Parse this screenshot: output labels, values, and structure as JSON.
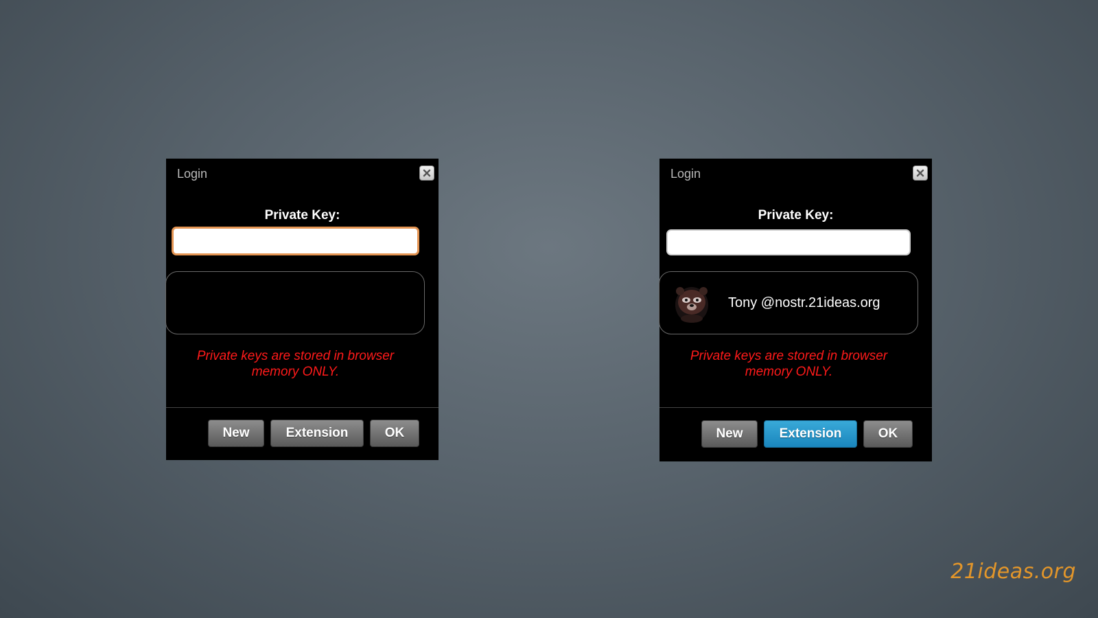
{
  "dialogs": [
    {
      "title": "Login",
      "private_key_label": "Private Key:",
      "private_key_value": "",
      "profile": null,
      "warning_line1": "Private keys are stored in browser",
      "warning_line2": "memory ONLY.",
      "buttons": {
        "new": "New",
        "extension": "Extension",
        "ok": "OK"
      },
      "input_state": "focused"
    },
    {
      "title": "Login",
      "private_key_label": "Private Key:",
      "private_key_value": "",
      "profile": {
        "name": "Tony @nostr.21ideas.org",
        "avatar_icon": "bear-avatar-icon"
      },
      "warning_line1": "Private keys are stored in browser",
      "warning_line2": "memory ONLY.",
      "buttons": {
        "new": "New",
        "extension": "Extension",
        "ok": "OK"
      },
      "active_button": "extension"
    }
  ],
  "brand": "21ideas.org",
  "colors": {
    "background": "#58636c",
    "dialog": "#000000",
    "warning": "#ff1a1a",
    "focus_ring": "#e49452",
    "active_button": "#1a86bd",
    "brand": "#e3962a"
  }
}
